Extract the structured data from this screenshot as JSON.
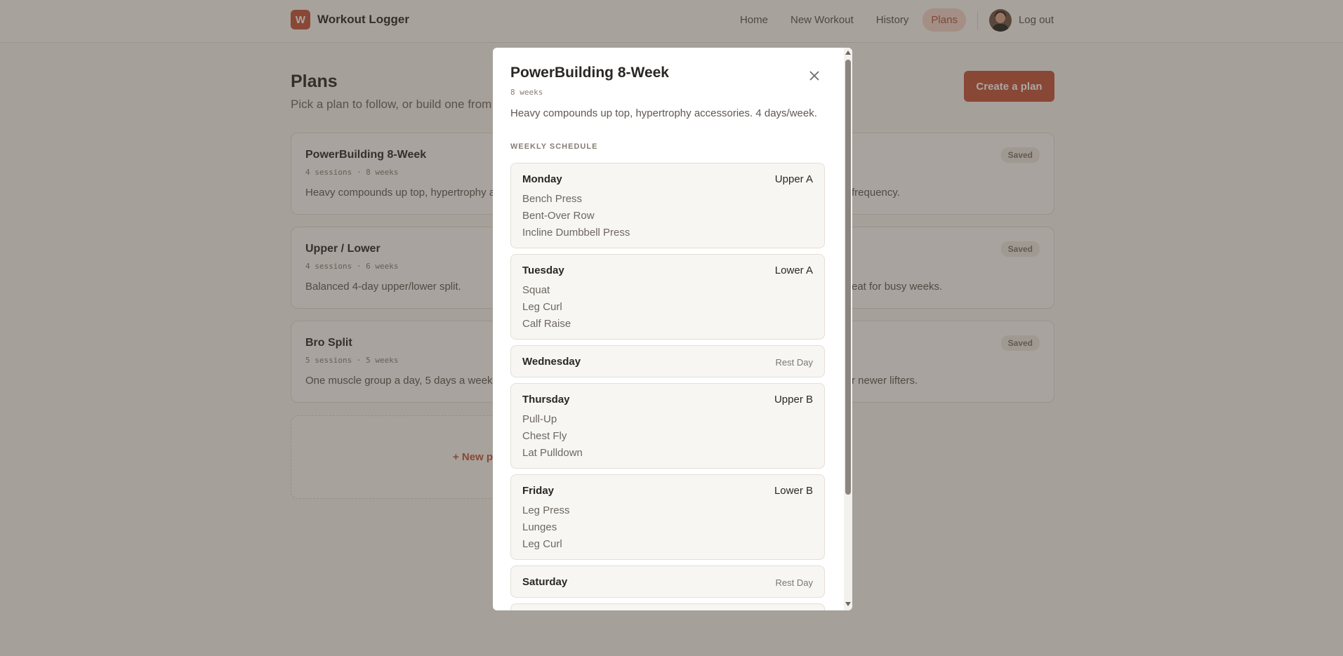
{
  "app": {
    "brand_initial": "W",
    "brand_name": "Workout Logger"
  },
  "nav": {
    "links": [
      "Home",
      "New Workout",
      "History",
      "Plans"
    ],
    "active": "Plans",
    "logout": "Log out"
  },
  "page": {
    "title": "Plans",
    "subtitle": "Pick a plan to follow, or build one from",
    "create_button": "Create a plan"
  },
  "cards": [
    {
      "title": "PowerBuilding 8-Week",
      "meta": "4 sessions · 8 weeks",
      "desc": "Heavy compounds up top, hypertrophy a"
    },
    {
      "title": "Upper / Lower",
      "meta": "4 sessions · 6 weeks",
      "desc": "Balanced 4-day upper/lower split."
    },
    {
      "title": "Bro Split",
      "meta": "5 sessions · 5 weeks",
      "desc": "One muscle group a day, 5 days a week."
    },
    {
      "desc": "frequency.",
      "badge": "Saved"
    },
    {
      "desc": "eat for busy weeks.",
      "badge": "Saved"
    },
    {
      "desc": "r newer lifters.",
      "badge": "Saved"
    }
  ],
  "new_plan": "+ New pl",
  "modal": {
    "title": "PowerBuilding 8-Week",
    "weeks": "8 weeks",
    "description": "Heavy compounds up top, hypertrophy accessories. 4 days/week.",
    "section_label": "WEEKLY SCHEDULE",
    "days": [
      {
        "name": "Monday",
        "session": "Upper A",
        "exercises": [
          "Bench Press",
          "Bent-Over Row",
          "Incline Dumbbell Press"
        ]
      },
      {
        "name": "Tuesday",
        "session": "Lower A",
        "exercises": [
          "Squat",
          "Leg Curl",
          "Calf Raise"
        ]
      },
      {
        "name": "Wednesday",
        "session": "Rest Day",
        "exercises": []
      },
      {
        "name": "Thursday",
        "session": "Upper B",
        "exercises": [
          "Pull-Up",
          "Chest Fly",
          "Lat Pulldown"
        ]
      },
      {
        "name": "Friday",
        "session": "Lower B",
        "exercises": [
          "Leg Press",
          "Lunges",
          "Leg Curl"
        ]
      },
      {
        "name": "Saturday",
        "session": "Rest Day",
        "exercises": []
      }
    ]
  },
  "colors": {
    "accent": "#c4533a",
    "accent_soft": "#f2d5cb",
    "overlay": "rgba(66,58,48,0.45)"
  }
}
